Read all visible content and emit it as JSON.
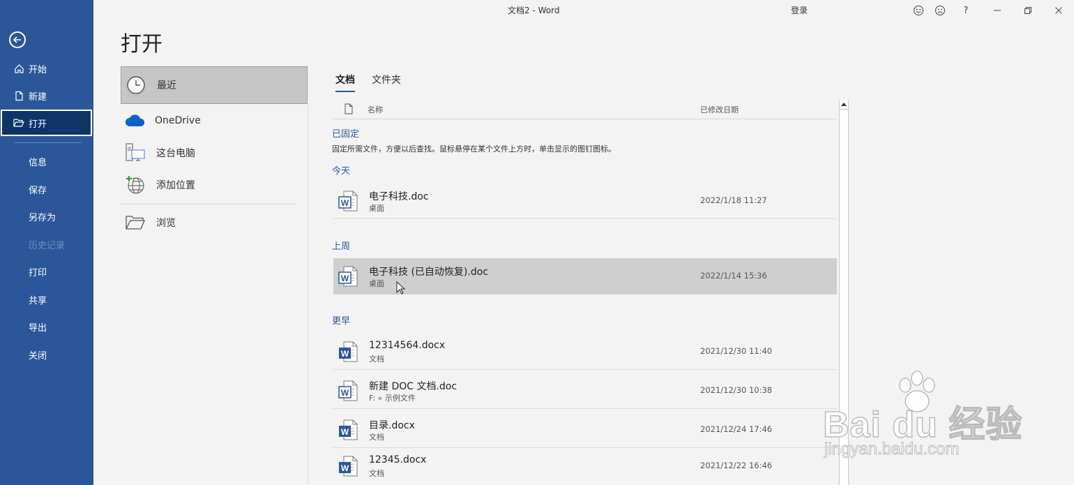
{
  "window": {
    "title": "文档2  -  Word",
    "login_label": "登录",
    "help_label": "?"
  },
  "nav": {
    "items": [
      {
        "label": "开始",
        "icon": "home-icon"
      },
      {
        "label": "新建",
        "icon": "new-document-icon"
      },
      {
        "label": "打开",
        "icon": "open-folder-icon",
        "active": true
      },
      {
        "label": "信息"
      },
      {
        "label": "保存"
      },
      {
        "label": "另存为"
      },
      {
        "label": "历史记录",
        "disabled": true
      },
      {
        "label": "打印"
      },
      {
        "label": "共享"
      },
      {
        "label": "导出"
      },
      {
        "label": "关闭"
      }
    ]
  },
  "page": {
    "title": "打开"
  },
  "locations": [
    {
      "label": "最近",
      "icon": "clock-icon",
      "active": true
    },
    {
      "label": "OneDrive",
      "icon": "cloud-icon"
    },
    {
      "label": "这台电脑",
      "icon": "computer-icon"
    },
    {
      "label": "添加位置",
      "icon": "add-place-icon"
    },
    {
      "label": "浏览",
      "icon": "browse-folder-icon"
    }
  ],
  "tabs": [
    {
      "label": "文档",
      "active": true
    },
    {
      "label": "文件夹"
    }
  ],
  "columns": {
    "name": "名称",
    "modified": "已修改日期"
  },
  "pinned": {
    "heading": "已固定",
    "hint": "固定所需文件，方便以后查找。鼠标悬停在某个文件上方时，单击显示的图钉图标。"
  },
  "groups": {
    "today": "今天",
    "last_week": "上周",
    "earlier": "更早"
  },
  "files": [
    {
      "name": "电子科技.doc",
      "location": "桌面",
      "date": "2022/1/18 11:27",
      "type": "doc"
    },
    {
      "name": "电子科技 (已自动恢复).doc",
      "location": "桌面",
      "date": "2022/1/14 15:36",
      "type": "doc",
      "hover": true
    },
    {
      "name": "12314564.docx",
      "location": "文档",
      "date": "2021/12/30 11:40",
      "type": "docx"
    },
    {
      "name": "新建 DOC 文档.doc",
      "location": "F: » 示例文件",
      "date": "2021/12/30 10:38",
      "type": "doc"
    },
    {
      "name": "目录.docx",
      "location": "文档",
      "date": "2021/12/24 17:46",
      "type": "docx"
    },
    {
      "name": "12345.docx",
      "location": "文档",
      "date": "2021/12/22 16:46",
      "type": "docx"
    }
  ],
  "watermark": {
    "brand": "Bai du 经验",
    "url": "jingyan.baidu.com"
  },
  "colors": {
    "accent": "#2b579a",
    "nav_active": "#0f3466",
    "hover_row": "#cfcfcf"
  }
}
